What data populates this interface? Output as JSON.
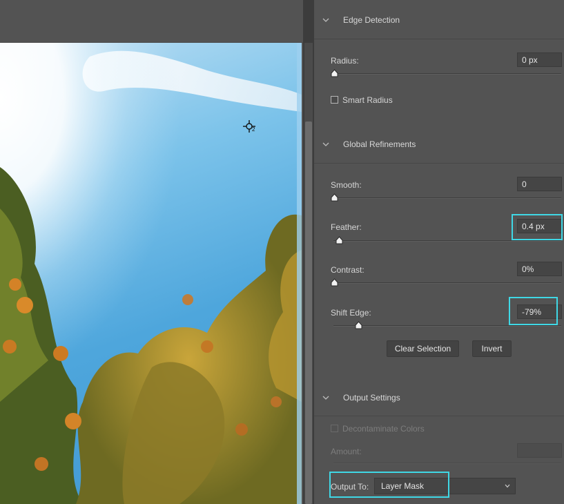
{
  "cursor": {
    "icon": "refine-radius-crosshair-icon",
    "badge": "2"
  },
  "sections": {
    "edge_detection": {
      "title": "Edge Detection",
      "radius": {
        "label": "Radius:",
        "value": "0 px",
        "slider": 0.0
      },
      "smart_radius": {
        "label": "Smart Radius",
        "checked": false
      }
    },
    "global_refinements": {
      "title": "Global Refinements",
      "smooth": {
        "label": "Smooth:",
        "value": "0",
        "slider": 0.0
      },
      "feather": {
        "label": "Feather:",
        "value": "0.4 px",
        "slider": 0.02
      },
      "contrast": {
        "label": "Contrast:",
        "value": "0%",
        "slider": 0.0
      },
      "shift_edge": {
        "label": "Shift Edge:",
        "value": "-79%",
        "slider": 0.105
      },
      "clear_selection_label": "Clear Selection",
      "invert_label": "Invert"
    },
    "output_settings": {
      "title": "Output Settings",
      "decontaminate": {
        "label": "Decontaminate Colors",
        "checked": false,
        "disabled": true
      },
      "amount": {
        "label": "Amount:",
        "value": ""
      },
      "output_to": {
        "label": "Output To:",
        "selected": "Layer Mask"
      }
    }
  },
  "colors": {
    "panel_bg": "#535353",
    "highlight": "#3fd8e6",
    "sky": "#4ea6dc"
  }
}
